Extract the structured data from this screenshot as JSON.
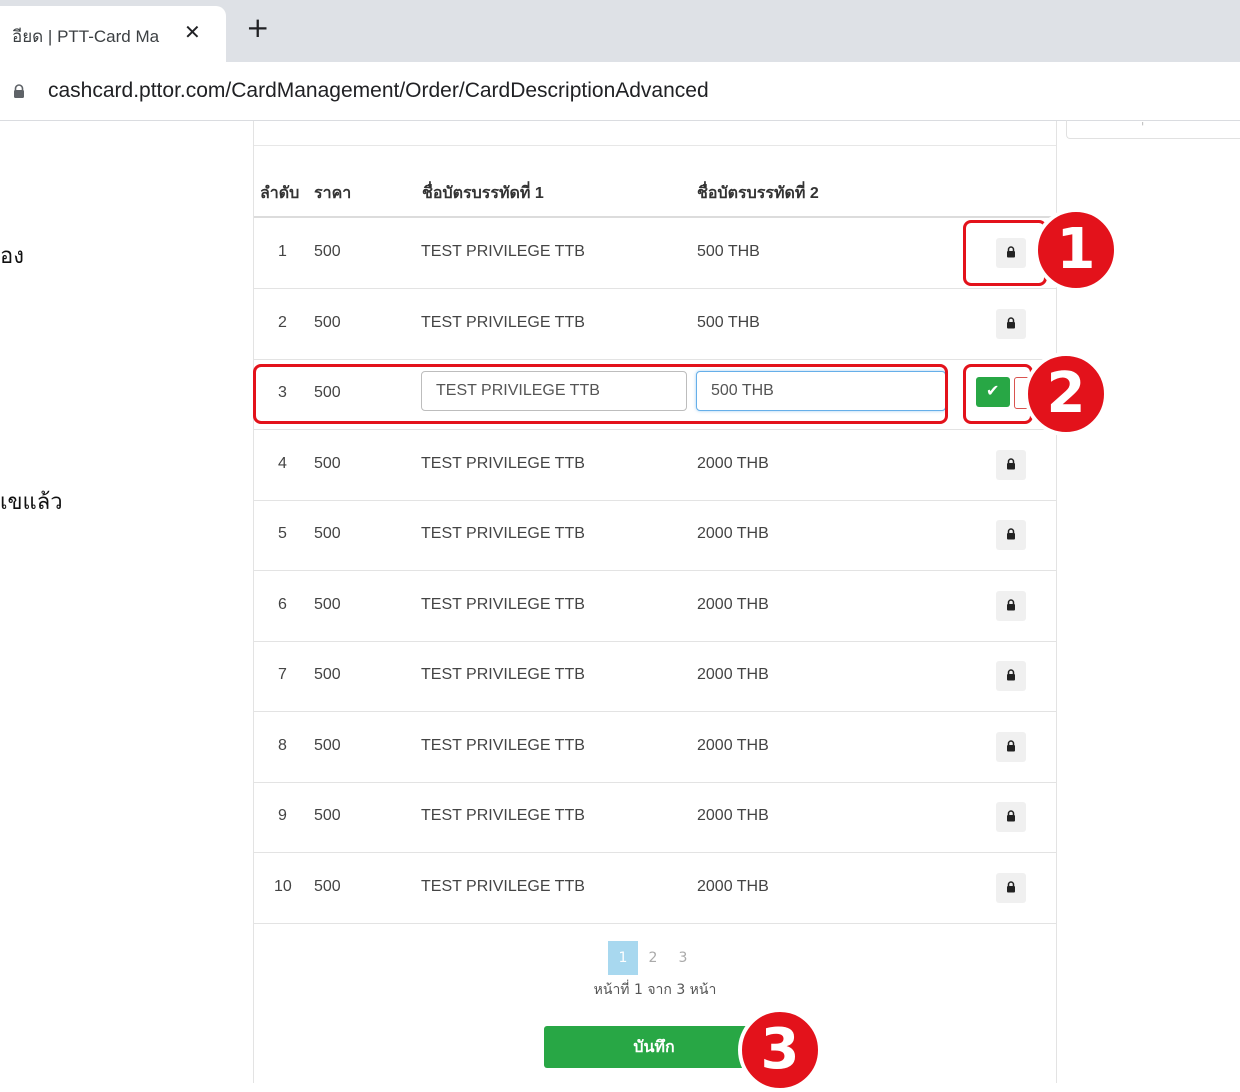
{
  "browser": {
    "tab_title": "อียด | PTT-Card Ma",
    "tab_close": "✕",
    "new_tab": "+",
    "url": "cashcard.pttor.com/CardManagement/Order/CardDescriptionAdvanced"
  },
  "side_text": {
    "line1": "อง",
    "line2": "เขแล้ว"
  },
  "table": {
    "headers": {
      "index": "ลำดับ",
      "price": "ราคา",
      "name_line1": "ชื่อบัตรบรรทัดที่ 1",
      "name_line2": "ชื่อบัตรบรรทัดที่ 2"
    },
    "rows": [
      {
        "index": "1",
        "price": "500",
        "line1": "TEST PRIVILEGE TTB",
        "line2": "500 THB"
      },
      {
        "index": "2",
        "price": "500",
        "line1": "TEST PRIVILEGE TTB",
        "line2": "500 THB"
      },
      {
        "index": "3",
        "price": "500",
        "line1": "TEST PRIVILEGE TTB",
        "line2": "500 THB"
      },
      {
        "index": "4",
        "price": "500",
        "line1": "TEST PRIVILEGE TTB",
        "line2": "2000 THB"
      },
      {
        "index": "5",
        "price": "500",
        "line1": "TEST PRIVILEGE TTB",
        "line2": "2000 THB"
      },
      {
        "index": "6",
        "price": "500",
        "line1": "TEST PRIVILEGE TTB",
        "line2": "2000 THB"
      },
      {
        "index": "7",
        "price": "500",
        "line1": "TEST PRIVILEGE TTB",
        "line2": "2000 THB"
      },
      {
        "index": "8",
        "price": "500",
        "line1": "TEST PRIVILEGE TTB",
        "line2": "2000 THB"
      },
      {
        "index": "9",
        "price": "500",
        "line1": "TEST PRIVILEGE TTB",
        "line2": "2000 THB"
      },
      {
        "index": "10",
        "price": "500",
        "line1": "TEST PRIVILEGE TTB",
        "line2": "2000 THB"
      }
    ],
    "editing_row": 3,
    "confirm_glyph": "✔"
  },
  "pagination": {
    "pages": [
      "1",
      "2",
      "3"
    ],
    "current": "1",
    "info": "หน้าที่ 1 จาก 3 หน้า"
  },
  "save_label": "บันทึก",
  "markers": [
    "1",
    "2",
    "3"
  ],
  "colors": {
    "highlight": "#e3121b",
    "success": "#28a745",
    "active_page": "#a8d8ef"
  }
}
